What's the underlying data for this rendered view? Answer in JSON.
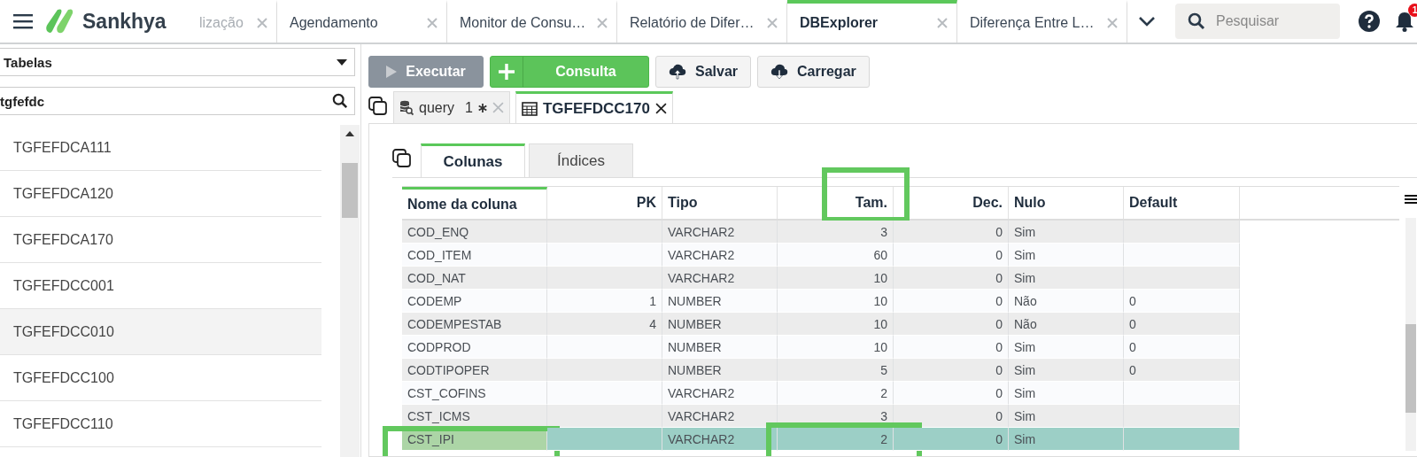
{
  "header": {
    "logo": "Sankhya",
    "tabs": [
      {
        "label": "lização",
        "selected": false,
        "faded": true
      },
      {
        "label": "Agendamento",
        "selected": false,
        "faded": false
      },
      {
        "label": "Monitor de Consu…",
        "selected": false,
        "faded": false
      },
      {
        "label": "Relatório de Difer…",
        "selected": false,
        "faded": false
      },
      {
        "label": "DBExplorer",
        "selected": true,
        "faded": false
      },
      {
        "label": "Diferença Entre L…",
        "selected": false,
        "faded": false
      }
    ],
    "search": {
      "placeholder": "Pesquisar"
    },
    "notifications": "1"
  },
  "sidebar": {
    "dropdown": "Tabelas",
    "search": {
      "value": "tgfefdc"
    },
    "items": [
      {
        "label": "TGFEFDCA111",
        "selected": false
      },
      {
        "label": "TGFEFDCA120",
        "selected": false
      },
      {
        "label": "TGFEFDCA170",
        "selected": false
      },
      {
        "label": "TGFEFDCC001",
        "selected": false
      },
      {
        "label": "TGFEFDCC010",
        "selected": true
      },
      {
        "label": "TGFEFDCC100",
        "selected": false
      },
      {
        "label": "TGFEFDCC110",
        "selected": false
      }
    ]
  },
  "toolbar": [
    {
      "label": "Executar",
      "kind": "run",
      "disabled": true
    },
    {
      "label": "Consulta",
      "kind": "add",
      "disabled": false
    },
    {
      "label": "Salvar",
      "kind": "save",
      "disabled": false
    },
    {
      "label": "Carregar",
      "kind": "load",
      "disabled": false
    }
  ],
  "editor_tabs": [
    {
      "label": "query",
      "count": "1",
      "kind": "query",
      "modified": true,
      "selected": false
    },
    {
      "label": "TGFEFDCC170",
      "kind": "table",
      "modified": false,
      "selected": true
    }
  ],
  "detail_tabs": [
    {
      "label": "Colunas",
      "selected": true
    },
    {
      "label": "Índices",
      "selected": false
    }
  ],
  "table": {
    "columns": [
      {
        "label": "Nome da coluna",
        "kind": "text",
        "framed": false
      },
      {
        "label": "PK",
        "kind": "number",
        "framed": false
      },
      {
        "label": "Tipo",
        "kind": "text",
        "framed": false
      },
      {
        "label": "Tam.",
        "kind": "number",
        "framed": true
      },
      {
        "label": "Dec.",
        "kind": "number",
        "framed": false
      },
      {
        "label": "Nulo",
        "kind": "text",
        "framed": false
      },
      {
        "label": "Default",
        "kind": "text",
        "framed": false
      }
    ],
    "rows": [
      {
        "cells": [
          "COD_ENQ",
          null,
          "VARCHAR2",
          "3",
          "0",
          "Sim",
          null
        ],
        "selected": false
      },
      {
        "cells": [
          "COD_ITEM",
          null,
          "VARCHAR2",
          "60",
          "0",
          "Sim",
          null
        ],
        "selected": false
      },
      {
        "cells": [
          "COD_NAT",
          null,
          "VARCHAR2",
          "10",
          "0",
          "Sim",
          null
        ],
        "selected": false
      },
      {
        "cells": [
          "CODEMP",
          "1",
          "NUMBER",
          "10",
          "0",
          "Não",
          "0"
        ],
        "selected": false
      },
      {
        "cells": [
          "CODEMPESTAB",
          "4",
          "NUMBER",
          "10",
          "0",
          "Não",
          "0"
        ],
        "selected": false
      },
      {
        "cells": [
          "CODPROD",
          null,
          "NUMBER",
          "10",
          "0",
          "Sim",
          "0"
        ],
        "selected": false
      },
      {
        "cells": [
          "CODTIPOPER",
          null,
          "NUMBER",
          "5",
          "0",
          "Sim",
          "0"
        ],
        "selected": false
      },
      {
        "cells": [
          "CST_COFINS",
          null,
          "VARCHAR2",
          "2",
          "0",
          "Sim",
          null
        ],
        "selected": false
      },
      {
        "cells": [
          "CST_ICMS",
          null,
          "VARCHAR2",
          "3",
          "0",
          "Sim",
          null
        ],
        "selected": false
      },
      {
        "cells": [
          "CST_IPI",
          null,
          "VARCHAR2",
          "2",
          "0",
          "Sim",
          null
        ],
        "selected": true,
        "framed_cells": [
          true,
          false,
          false,
          true,
          false,
          false,
          false
        ]
      }
    ]
  }
}
